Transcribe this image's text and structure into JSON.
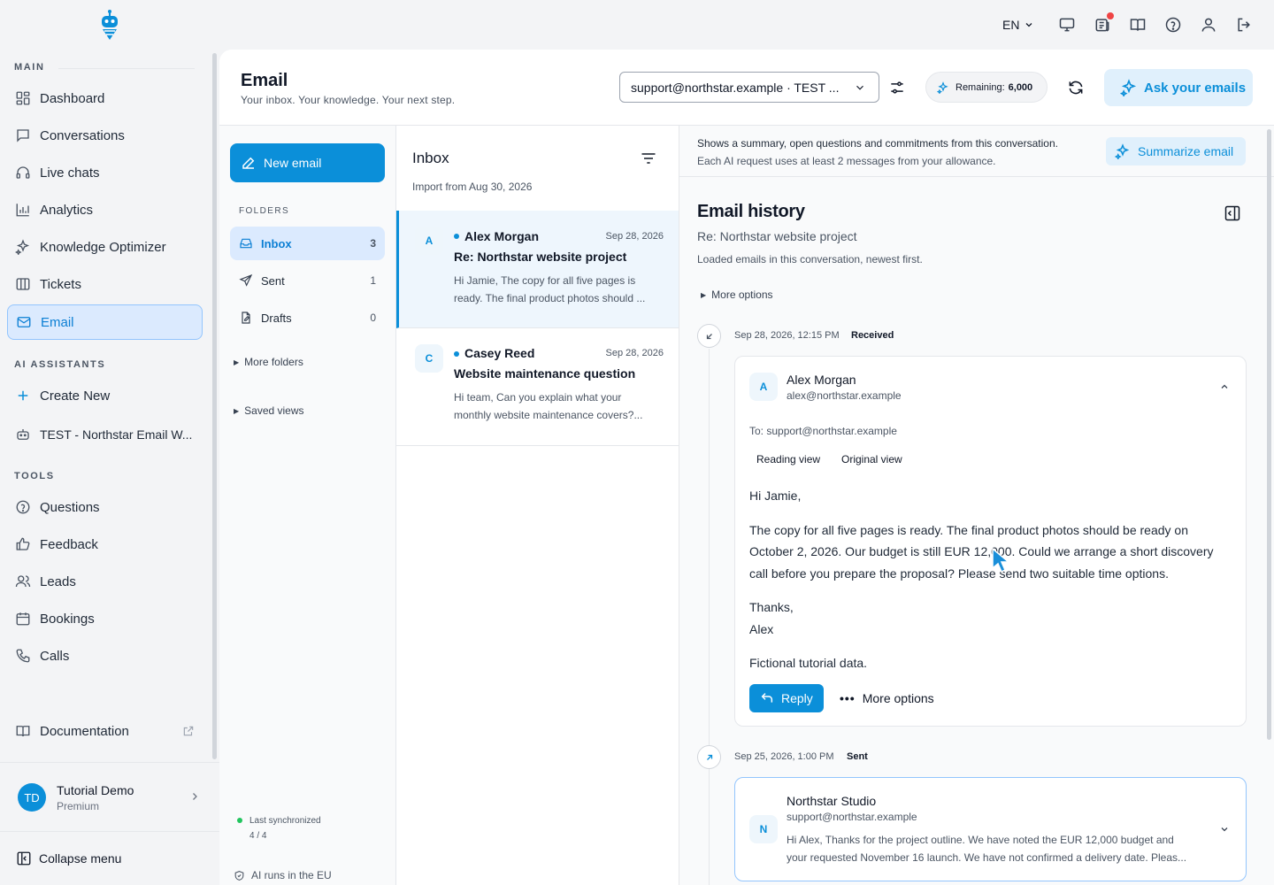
{
  "colors": {
    "accent": "#0b8fd9",
    "accent_light": "#dbeafe",
    "online": "#22c55e"
  },
  "topbar": {
    "language": "EN",
    "icons": [
      "monitor-icon",
      "news-icon",
      "book-icon",
      "help-icon",
      "user-icon",
      "logout-icon"
    ]
  },
  "sidebar": {
    "sections": {
      "main": "MAIN",
      "ai": "AI ASSISTANTS",
      "tools": "TOOLS"
    },
    "main_items": [
      {
        "label": "Dashboard",
        "icon": "dashboard-icon"
      },
      {
        "label": "Conversations",
        "icon": "chat-icon"
      },
      {
        "label": "Live chats",
        "icon": "headset-icon"
      },
      {
        "label": "Analytics",
        "icon": "chart-icon"
      },
      {
        "label": "Knowledge Optimizer",
        "icon": "sparkle-icon"
      },
      {
        "label": "Tickets",
        "icon": "columns-icon"
      },
      {
        "label": "Email",
        "icon": "inbox-icon",
        "active": true
      }
    ],
    "ai_items": [
      {
        "label": "Create New",
        "icon": "plus-icon"
      },
      {
        "label": "TEST - Northstar Email W...",
        "icon": "bot-icon"
      }
    ],
    "tool_items": [
      {
        "label": "Questions",
        "icon": "question-icon"
      },
      {
        "label": "Feedback",
        "icon": "thumbs-up-icon"
      },
      {
        "label": "Leads",
        "icon": "users-icon"
      },
      {
        "label": "Bookings",
        "icon": "calendar-icon"
      },
      {
        "label": "Calls",
        "icon": "phone-icon"
      }
    ],
    "documentation": "Documentation",
    "user": {
      "initials": "TD",
      "name": "Tutorial Demo",
      "plan": "Premium"
    },
    "collapse": "Collapse menu"
  },
  "header": {
    "title": "Email",
    "subtitle": "Your inbox. Your knowledge. Your next step.",
    "account_select": "support@northstar.example · TEST ...",
    "remaining_label": "Remaining:",
    "remaining_value": "6,000",
    "ask_button": "Ask your emails"
  },
  "folders": {
    "new_email": "New email",
    "heading": "FOLDERS",
    "items": [
      {
        "label": "Inbox",
        "count": "3",
        "icon": "inbox-icon",
        "active": true
      },
      {
        "label": "Sent",
        "count": "1",
        "icon": "send-icon"
      },
      {
        "label": "Drafts",
        "count": "0",
        "icon": "draft-icon"
      }
    ],
    "more_folders": "More folders",
    "saved_views": "Saved views",
    "sync_label": "Last synchronized",
    "sync_count": "4 / 4",
    "eu_label": "AI runs in the EU"
  },
  "inbox": {
    "title": "Inbox",
    "import_text": "Import from Aug 30, 2026",
    "messages": [
      {
        "initial": "A",
        "sender": "Alex Morgan",
        "date": "Sep 28, 2026",
        "subject": "Re: Northstar website project",
        "preview1": "Hi Jamie, The copy for all five pages is",
        "preview2": "ready. The final product photos should ..."
      },
      {
        "initial": "C",
        "sender": "Casey Reed",
        "date": "Sep 28, 2026",
        "subject": "Website maintenance question",
        "preview1": "Hi team, Can you explain what your",
        "preview2": "monthly website maintenance covers?..."
      }
    ]
  },
  "detail": {
    "summary_line1": "Shows a summary, open questions and commitments from this conversation.",
    "summary_line2": "Each AI request uses at least 2 messages from your allowance.",
    "summarize_button": "Summarize email",
    "history_title": "Email history",
    "history_subject": "Re: Northstar website project",
    "history_note": "Loaded emails in this conversation, newest first.",
    "more_options": "More options",
    "entries": [
      {
        "datetime": "Sep 28, 2026, 12:15 PM",
        "status": "Received",
        "initial": "A",
        "sender": "Alex Morgan",
        "email": "alex@northstar.example",
        "to": "To: support@northstar.example",
        "view_reading": "Reading view",
        "view_original": "Original view",
        "greeting": "Hi Jamie,",
        "body1": "The copy for all five pages is ready. The final product photos should be ready on",
        "body2": "October 2, 2026. Our budget is still EUR 12,000. Could we arrange a short discovery",
        "body3": "call before you prepare the proposal? Please send two suitable time options.",
        "thanks": "Thanks,",
        "signoff": "Alex",
        "footer": "Fictional tutorial data.",
        "reply": "Reply",
        "more_options": "More options"
      },
      {
        "datetime": "Sep 25, 2026, 1:00 PM",
        "status": "Sent",
        "initial": "N",
        "sender": "Northstar Studio",
        "email": "support@northstar.example",
        "preview1": "Hi Alex, Thanks for the project outline. We have noted the EUR 12,000 budget and",
        "preview2": "your requested November 16 launch. We have not confirmed a delivery date. Pleas..."
      }
    ]
  }
}
